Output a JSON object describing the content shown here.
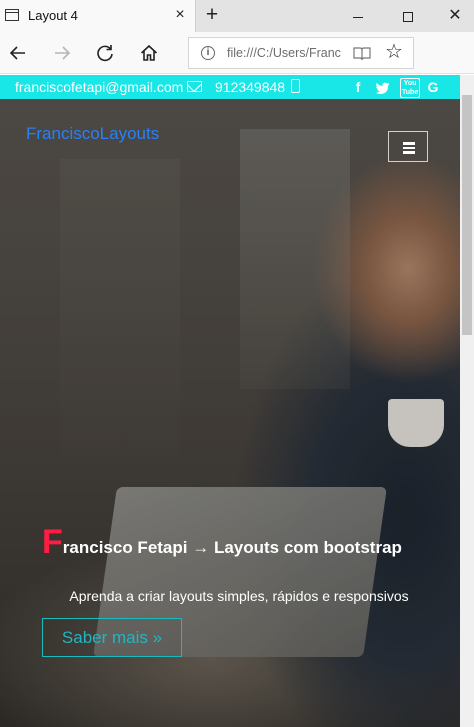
{
  "browser": {
    "tab_title": "Layout 4",
    "tab_close": "×",
    "new_tab": "+",
    "url": "file:///C:/Users/Franc",
    "window_minimize": "",
    "window_maximize": "",
    "window_close": "✕",
    "favorite_glyph": "☆"
  },
  "topbar": {
    "email": "franciscofetapi@gmail.com",
    "phone": "912349848",
    "social": [
      "f",
      "t",
      "You Tube",
      "G"
    ]
  },
  "navbar": {
    "brand": "FranciscoLayouts"
  },
  "hero": {
    "title_initial": "F",
    "title_rest": "rancisco Fetapi → Layouts com bootstrap",
    "subtitle": "Aprenda a criar layouts simples, rápidos e responsivos",
    "cta": "Saber mais »"
  },
  "colors": {
    "topbar": "#19e6e6",
    "brand": "#2a80f5",
    "initial": "#ff1d43",
    "cta": "#22b6c2"
  },
  "icons": [
    "tab-page-icon",
    "back-icon",
    "forward-icon",
    "reload-icon",
    "home-icon",
    "info-icon",
    "reading-view-icon",
    "star-icon",
    "mail-icon",
    "phone-icon",
    "facebook-icon",
    "twitter-icon",
    "youtube-icon",
    "google-icon",
    "hamburger-icon"
  ]
}
